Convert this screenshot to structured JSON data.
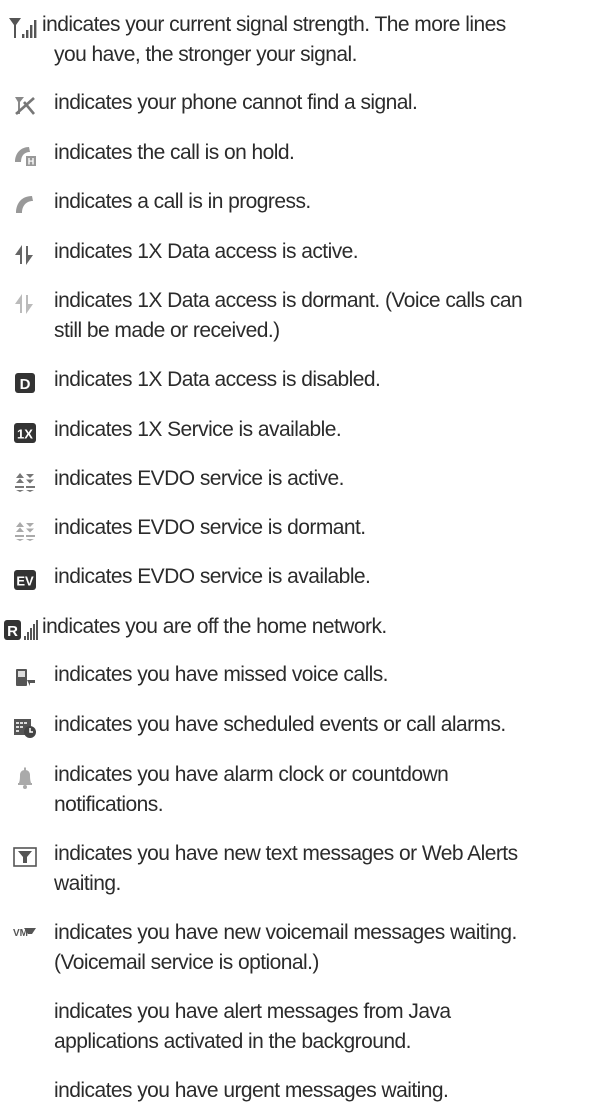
{
  "entries": [
    {
      "icon": "signal-strength-icon",
      "text": "indicates your current signal strength. The more lines",
      "text2": "you have, the stronger your signal."
    },
    {
      "icon": "no-signal-icon",
      "text": "indicates your phone cannot find a signal."
    },
    {
      "icon": "call-on-hold-icon",
      "text": "indicates the call is on hold."
    },
    {
      "icon": "call-in-progress-icon",
      "text": "indicates a call is in progress."
    },
    {
      "icon": "data-active-icon",
      "text": "indicates 1X Data access is active."
    },
    {
      "icon": "data-dormant-icon",
      "text": "indicates 1X Data access is dormant. (Voice calls can",
      "text2": "still be made or received.)"
    },
    {
      "icon": "data-disabled-icon",
      "text": "indicates 1X Data access is disabled.",
      "glyph": "D"
    },
    {
      "icon": "1x-service-icon",
      "text": "indicates 1X Service is available.",
      "glyph": "1X"
    },
    {
      "icon": "evdo-active-icon",
      "text": "indicates EVDO service is active."
    },
    {
      "icon": "evdo-dormant-icon",
      "text": "indicates EVDO service is dormant."
    },
    {
      "icon": "evdo-available-icon",
      "text": "indicates EVDO service is available.",
      "glyph": "EV"
    },
    {
      "icon": "roaming-icon",
      "text": "indicates you are off the home network.",
      "glyph": "R"
    },
    {
      "icon": "missed-calls-icon",
      "text": "indicates you have missed voice calls."
    },
    {
      "icon": "scheduled-events-icon",
      "text": "indicates you have scheduled events or call alarms."
    },
    {
      "icon": "alarm-bell-icon",
      "text": "indicates you have alarm clock or countdown",
      "text2": "notifications."
    },
    {
      "icon": "text-message-icon",
      "text": "indicates you have new text messages or Web Alerts",
      "text2": "waiting."
    },
    {
      "icon": "voicemail-icon",
      "text": "indicates you have new voicemail messages waiting.",
      "text2": "(Voicemail service is optional.)",
      "glyph": "VM"
    },
    {
      "icon": "java-alert-icon",
      "text": "indicates you have alert messages from Java",
      "text2": "applications activated in the background."
    },
    {
      "icon": "urgent-message-icon",
      "text": "indicates you have urgent messages waiting."
    }
  ]
}
